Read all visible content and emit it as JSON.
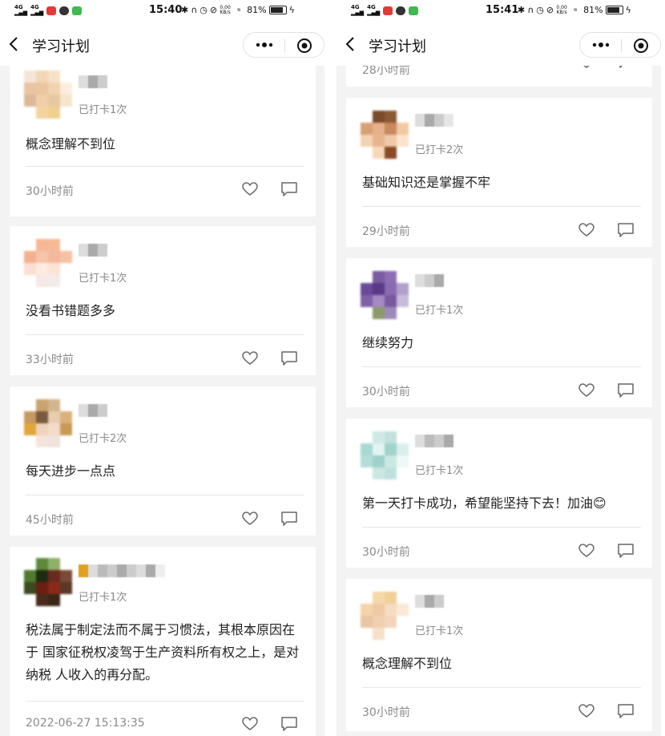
{
  "panes": [
    {
      "status": {
        "time": "15:40",
        "battery": "81%"
      },
      "nav": {
        "title": "学习计划"
      },
      "cards": [
        {
          "checkin": "已打卡1次",
          "text": "概念理解不到位",
          "time": "30小时前"
        },
        {
          "checkin": "已打卡1次",
          "text": "没看书错题多多",
          "time": "33小时前"
        },
        {
          "checkin": "已打卡2次",
          "text": "每天进步一点点",
          "time": "45小时前"
        },
        {
          "checkin": "已打卡1次",
          "text": "税法属于制定法而不属于习惯法，其根本原因在于 国家征税权凌驾于生产资料所有权之上，是对纳税 人收入的再分配。",
          "time": "2022-06-27 15:13:35"
        }
      ]
    },
    {
      "status": {
        "time": "15:41",
        "battery": "81%"
      },
      "nav": {
        "title": "学习计划"
      },
      "partial": {
        "time": "28小时前"
      },
      "cards": [
        {
          "checkin": "已打卡2次",
          "text": "基础知识还是掌握不牢",
          "time": "29小时前"
        },
        {
          "checkin": "已打卡1次",
          "text": "继续努力",
          "time": "30小时前"
        },
        {
          "checkin": "已打卡1次",
          "text": "第一天打卡成功，希望能坚持下去！加油😊",
          "time": "30小时前"
        },
        {
          "checkin": "已打卡1次",
          "text": "概念理解不到位",
          "time": "30小时前"
        }
      ]
    }
  ],
  "icons": {
    "back": "chevron-left-icon",
    "more": "more-dots-icon",
    "target": "record-target-icon",
    "like": "heart-icon",
    "comment": "comment-icon"
  },
  "colors": {
    "page_bg": "#f3f3f3",
    "card_bg": "#ffffff",
    "muted_text": "#8a8a8a",
    "body_text": "#222222"
  }
}
